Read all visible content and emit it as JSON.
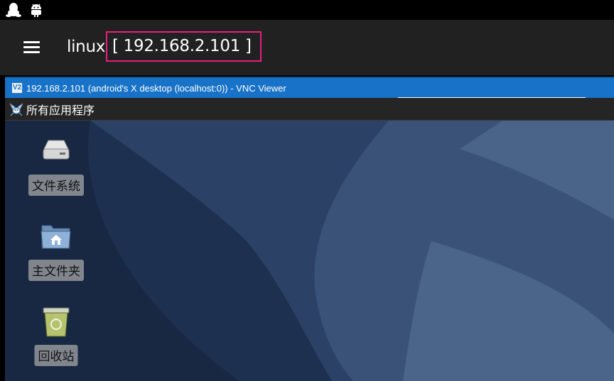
{
  "status_bar": {
    "icons": [
      "qq-penguin-icon",
      "android-robot-icon"
    ]
  },
  "app_bar": {
    "menu_icon": "hamburger-menu-icon",
    "title": "linux",
    "host": "[ 192.168.2.101 ]"
  },
  "vnc_window": {
    "logo": "V2",
    "title": "192.168.2.101 (android's X desktop (localhost:0)) - VNC Viewer"
  },
  "panel": {
    "applications_menu": "所有应用程序"
  },
  "desktop": {
    "icons": [
      {
        "label": "文件系统",
        "icon": "drive-harddisk-icon"
      },
      {
        "label": "主文件夹",
        "icon": "home-folder-icon"
      },
      {
        "label": "回收站",
        "icon": "trash-icon"
      }
    ]
  },
  "colors": {
    "highlight_border": "#e91e7a",
    "titlebar": "#1873c8",
    "appbar": "#212121",
    "wallpaper": "#263a5a"
  }
}
